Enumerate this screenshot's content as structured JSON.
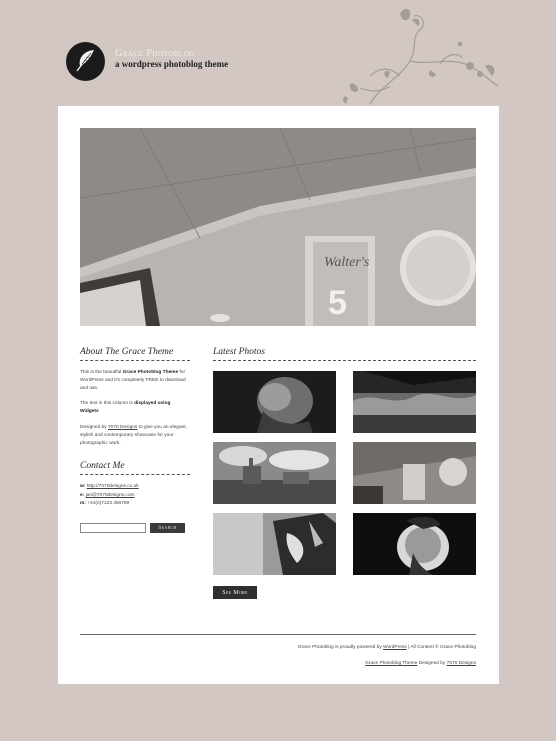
{
  "header": {
    "site_title": "Grace Photoblog",
    "tagline": "a wordpress photoblog theme"
  },
  "sidebar": {
    "about": {
      "title": "About The Grace Theme",
      "p1_a": "This is the beautiful ",
      "p1_bold": "Grace Photoblog Theme",
      "p1_b": " for WordPress and it's completely FREE to download and use.",
      "p2_a": "The text in this column is ",
      "p2_bold": "displayed using Widgets",
      "p3_a": "Designed by ",
      "p3_link": "7070 Designs",
      "p3_b": " to give you an elegant, stylish and contemporary showcase for your photographic work."
    },
    "contact": {
      "title": "Contact Me",
      "web_label": "w:",
      "web_link": "http://7070designs.co.uk",
      "email_label": "e:",
      "email_link": "jan@7070designs.com",
      "mobile_label": "m:",
      "mobile_value": "+44(0)7123 456789"
    },
    "search": {
      "placeholder": "",
      "button": "Search"
    }
  },
  "latest": {
    "title": "Latest Photos",
    "see_more": "See More"
  },
  "footer": {
    "line1_a": "Grace Photoblog is proudly powered by ",
    "line1_link": "WordPress",
    "line1_b": " | All Content © Grace Photoblog",
    "line2_link1": "Grace Photoblog Theme",
    "line2_mid": " Designed by ",
    "line2_link2": "7070 Designs"
  },
  "colors": {
    "background": "#d2c7c3",
    "page": "#ffffff",
    "button": "#2f2f2f"
  }
}
